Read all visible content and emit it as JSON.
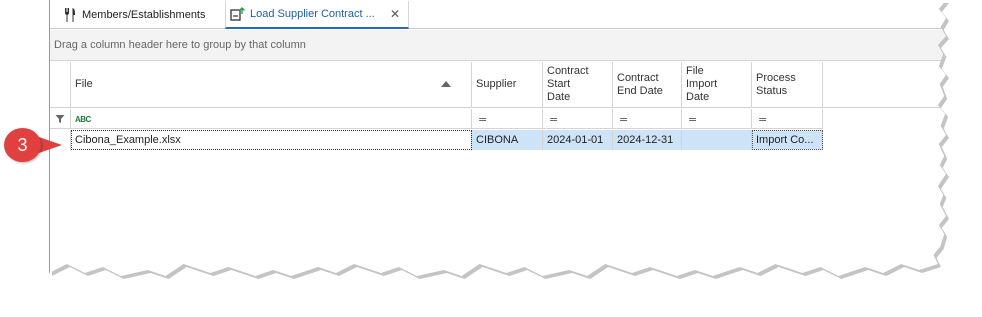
{
  "tabs": [
    {
      "label": "Members/Establishments",
      "icon": "fork-knife-icon"
    },
    {
      "label": "Load Supplier Contract ...",
      "icon": "load-contract-icon",
      "close": "✕",
      "active": true
    }
  ],
  "group_panel_text": "Drag a column header here to group by that column",
  "columns": [
    {
      "key": "file",
      "label": "File",
      "sorted": "ascending"
    },
    {
      "key": "supplier",
      "label": "Supplier"
    },
    {
      "key": "contract_start",
      "label": "Contract\nStart\nDate"
    },
    {
      "key": "contract_end",
      "label": "Contract\nEnd Date"
    },
    {
      "key": "file_import",
      "label": "File\nImport\nDate"
    },
    {
      "key": "process_status",
      "label": "Process\nStatus"
    }
  ],
  "filter_row": {
    "file_icon": "text-filter-icon",
    "file_icon_text": "ABC",
    "operator_symbol": "="
  },
  "rows": [
    {
      "file": "Cibona_Example.xlsx",
      "supplier": "CIBONA",
      "contract_start": "2024-01-01",
      "contract_end": "2024-12-31",
      "file_import": "",
      "process_status": "Import Co..."
    }
  ],
  "step_badge": "3",
  "colors": {
    "accent": "#2b6cb0",
    "selection": "#cde3f7",
    "badge": "#e0403f"
  }
}
